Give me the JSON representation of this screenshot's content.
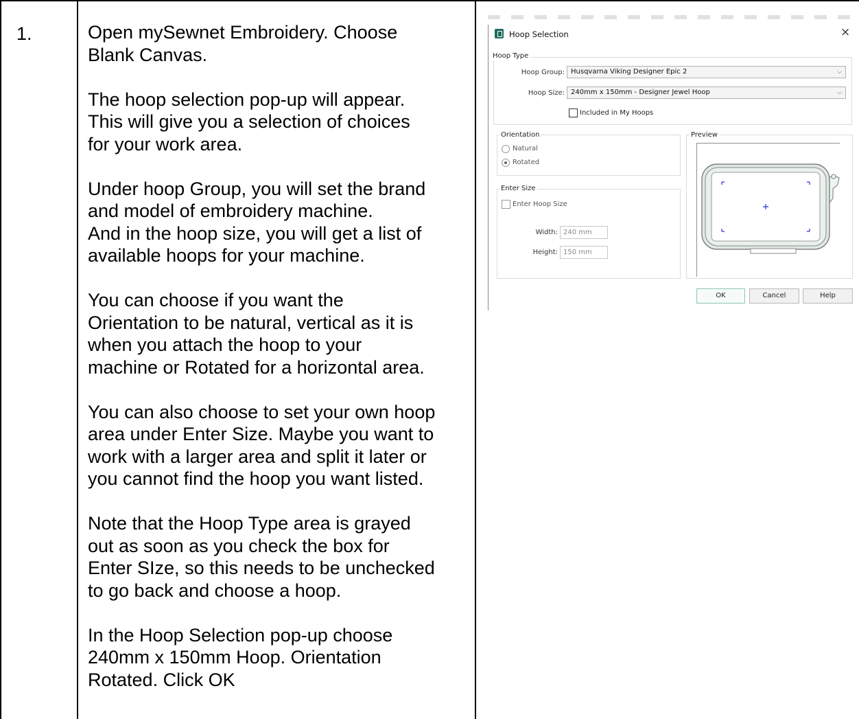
{
  "step": {
    "number": "1."
  },
  "instructions": [
    "Open mySewnet Embroidery. Choose\nBlank Canvas.",
    "The hoop selection pop-up will appear.\nThis will give you a selection of choices\nfor your work area.",
    "Under hoop Group, you will set the brand\nand model of embroidery machine.\nAnd in the hoop size, you will get a list of\navailable hoops for your machine.",
    "You can choose if you want the\nOrientation to be natural, vertical as it is\nwhen you attach the hoop to your\nmachine or Rotated for a horizontal area.",
    "You can also choose to set your own hoop\narea under Enter Size. Maybe you want to\nwork with a larger area and split it later or\nyou cannot find the hoop you want listed.",
    "Note that the Hoop Type area is grayed\nout as soon as you check the box for\nEnter SIze, so this needs to be unchecked\nto go back and choose a hoop.",
    "In the Hoop Selection pop-up choose\n240mm x 150mm Hoop. Orientation\nRotated. Click OK"
  ],
  "dialog": {
    "title": "Hoop Selection",
    "close_glyph": "×",
    "hoop_type": {
      "label": "Hoop Type",
      "group_label": "Hoop Group:",
      "group_value": "Husqvarna Viking Designer Epic 2",
      "size_label": "Hoop Size:",
      "size_value": "240mm x 150mm - Designer Jewel Hoop",
      "included_label": "Included in My Hoops",
      "included_checked": false
    },
    "orientation": {
      "label": "Orientation",
      "options": [
        {
          "label": "Natural",
          "selected": false
        },
        {
          "label": "Rotated",
          "selected": true
        }
      ]
    },
    "enter_size": {
      "label": "Enter Size",
      "checkbox_label": "Enter Hoop Size",
      "checked": false,
      "width_label": "Width:",
      "width_value": "240 mm",
      "height_label": "Height:",
      "height_value": "150 mm"
    },
    "preview": {
      "label": "Preview"
    },
    "buttons": {
      "ok": "OK",
      "cancel": "Cancel",
      "help": "Help"
    },
    "chevron_glyph": "⌵",
    "icons": [
      "app-icon",
      "close-icon",
      "chevron-down-icon",
      "hoop-preview"
    ],
    "colors": {
      "app_icon": "#1d6b5c",
      "hoop_marks": "#2b2bd6",
      "ok_border": "#8ec3b6"
    }
  }
}
